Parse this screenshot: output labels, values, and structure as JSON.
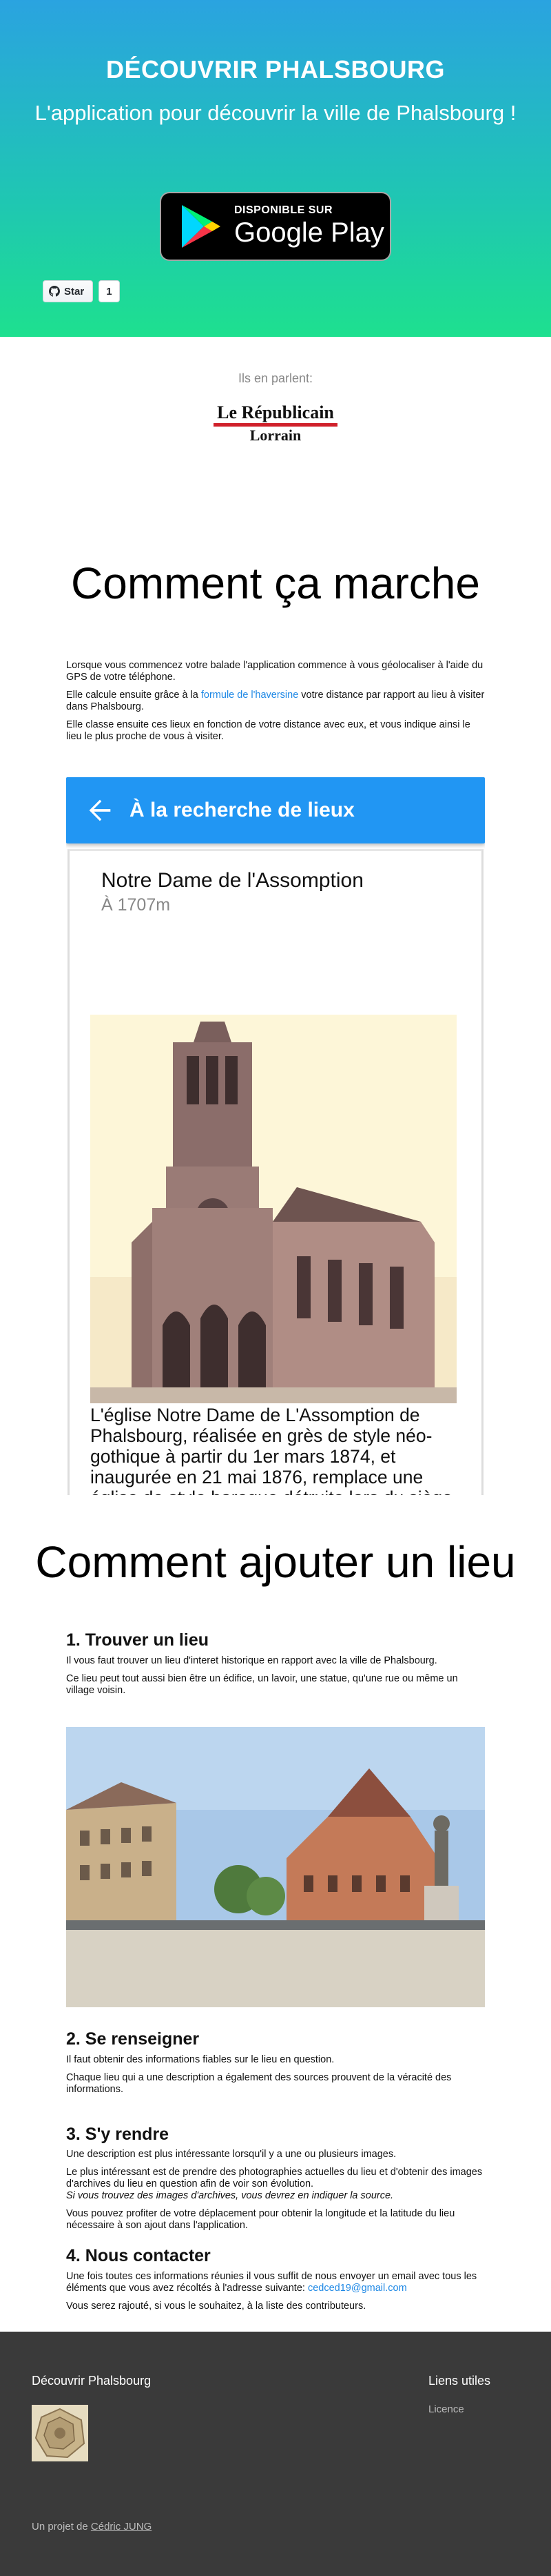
{
  "hero": {
    "title": "DÉCOUVRIR PHALSBOURG",
    "subtitle": "L'application pour découvrir la ville de Phalsbourg !",
    "badge_small": "DISPONIBLE SUR",
    "badge_big": "Google Play",
    "github_star": "Star",
    "github_count": "1"
  },
  "press": {
    "label": "Ils en parlent:",
    "logo_line1": "Le Républicain",
    "logo_line2": "Lorrain"
  },
  "how": {
    "heading": "Comment ça marche",
    "p1": "Lorsque vous commencez votre balade l'application commence à vous géolocaliser à l'aide du GPS de votre téléphone.",
    "p2_before": "Elle calcule ensuite grâce à la ",
    "p2_link": "formule de l'haversine",
    "p2_after": " votre distance par rapport au lieu à visiter dans Phalsbourg.",
    "p3": "Elle classe ensuite ces lieux en fonction de votre distance avec eux, et vous indique ainsi le lieu le plus proche de vous à visiter."
  },
  "app": {
    "bar_title": "À la recherche de lieux",
    "place_name": "Notre Dame de l'Assomption",
    "distance": "À 1707m",
    "description": "L'église Notre Dame de L'Assomption de Phalsbourg, réalisée en grès de style néo-gothique à partir du 1er mars 1874, et inaugurée en 21 mai 1876, remplace une église de style baroque détruite lors du siège de Phalsbourg en 1870. L'église devait être surmonté d'une flèche, mais elle ne fut jamais édifiée faute de financement. Les dommages de guerres accordés s'élevaient"
  },
  "add": {
    "heading": "Comment ajouter un lieu",
    "s1_title": "1. Trouver un lieu",
    "s1_p1": "Il vous faut trouver un lieu d'interet historique en rapport avec la ville de Phalsbourg.",
    "s1_p2": "Ce lieu peut tout aussi bien être un édifice, un lavoir, une statue, qu'une rue ou même un village voisin.",
    "s2_title": "2. Se renseigner",
    "s2_p1": "Il faut obtenir des informations fiables sur le lieu en question.",
    "s2_p2": "Chaque lieu qui a une description a également des sources prouvent de la véracité des informations.",
    "s3_title": "3. S'y rendre",
    "s3_p1": "Une description est plus intéressante lorsqu'il y a une ou plusieurs images.",
    "s3_p2": "Le plus intéressant est de prendre des photographies actuelles du lieu et d'obtenir des images d'archives du lieu en question afin de voir son évolution.",
    "s3_p2_em": "Si vous trouvez des images d'archives, vous devrez en indiquer la source.",
    "s3_p3": "Vous pouvez profiter de votre déplacement pour obtenir la longitude et la latitude du lieu nécessaire à son ajout dans l'application.",
    "s4_title": "4. Nous contacter",
    "s4_p1_before": "Une fois toutes ces informations réunies il vous suffit de nous envoyer un email avec tous les éléments que vous avez récoltés à l'adresse suivante: ",
    "s4_email": "cedced19@gmail.com",
    "s4_p2": "Vous serez rajouté, si vous le souhaitez, à la liste des contributeurs."
  },
  "footer": {
    "name": "Découvrir Phalsbourg",
    "credit_before": "Un projet de ",
    "credit_link": "Cédric JUNG",
    "links_title": "Liens utiles",
    "licence": "Licence"
  },
  "colors": {
    "accent": "#2196f3",
    "link": "#1e88e5",
    "hero_top": "#2aa3e0",
    "hero_bottom": "#1ee08f",
    "footer_bg": "#3a3a3a",
    "logo_red": "#d0202a"
  },
  "icons": [
    "play-store-icon",
    "github-mark-icon",
    "back-arrow-icon"
  ]
}
